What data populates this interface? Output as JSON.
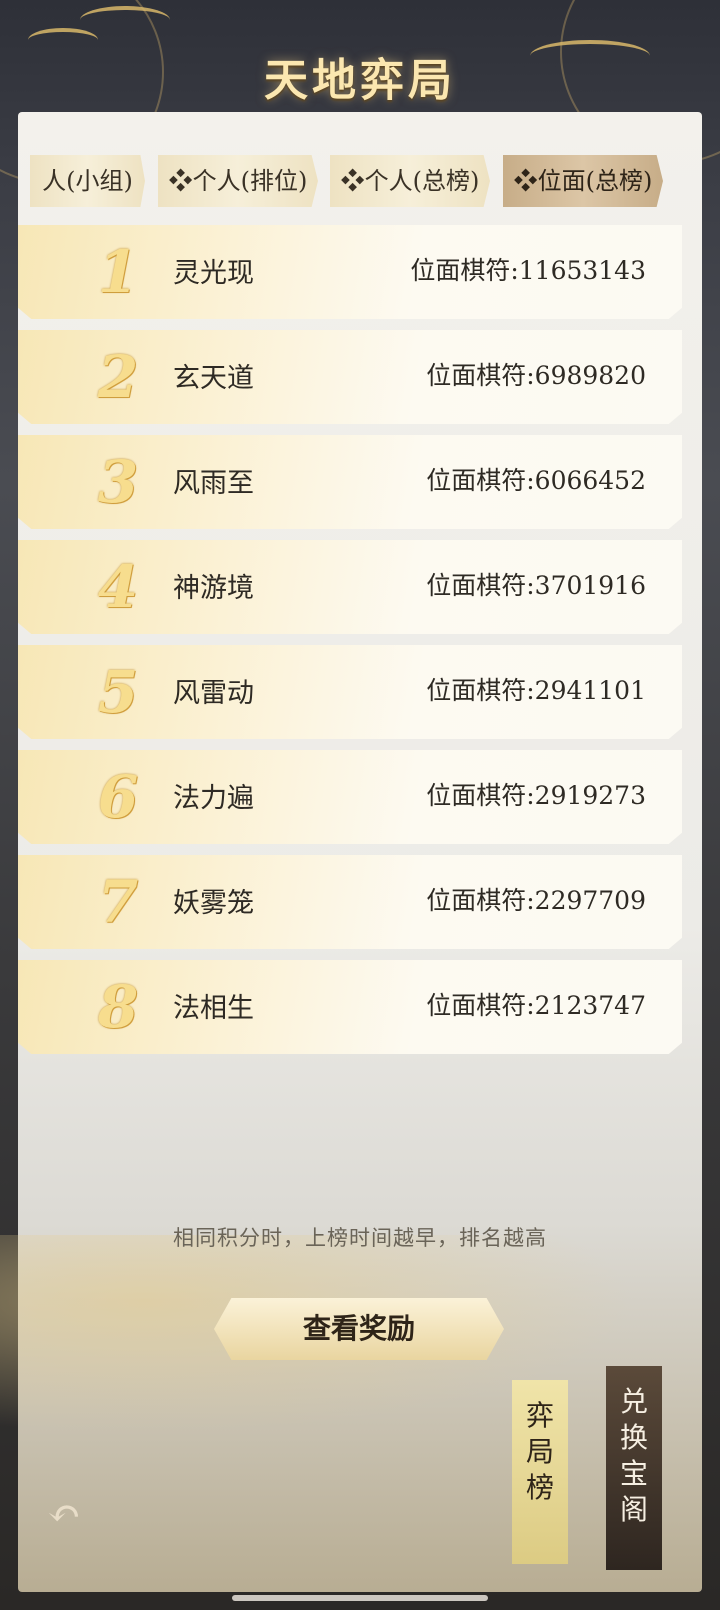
{
  "header": {
    "title": "天地弈局"
  },
  "tabs": [
    {
      "label": "人(小组)"
    },
    {
      "label": "❖个人(排位)"
    },
    {
      "label": "❖个人(总榜)"
    },
    {
      "label": "❖位面(总榜)"
    }
  ],
  "ranking": [
    {
      "rank": "1",
      "name": "灵光现",
      "score": "位面棋符:11653143"
    },
    {
      "rank": "2",
      "name": "玄天道",
      "score": "位面棋符:6989820"
    },
    {
      "rank": "3",
      "name": "风雨至",
      "score": "位面棋符:6066452"
    },
    {
      "rank": "4",
      "name": "神游境",
      "score": "位面棋符:3701916"
    },
    {
      "rank": "5",
      "name": "风雷动",
      "score": "位面棋符:2941101"
    },
    {
      "rank": "6",
      "name": "法力遍",
      "score": "位面棋符:2919273"
    },
    {
      "rank": "7",
      "name": "妖雾笼",
      "score": "位面棋符:2297709"
    },
    {
      "rank": "8",
      "name": "法相生",
      "score": "位面棋符:2123747"
    }
  ],
  "footer": {
    "note": "相同积分时，上榜时间越早，排名越高",
    "reward_button": "查看奖励",
    "tag_ranking": "弈局榜",
    "tag_exchange": "兑换宝阁",
    "back_icon": "undo-icon"
  },
  "colors": {
    "gold": "#f7dd8e",
    "panel": "#f3f1ec",
    "dark": "#2e2a24"
  }
}
